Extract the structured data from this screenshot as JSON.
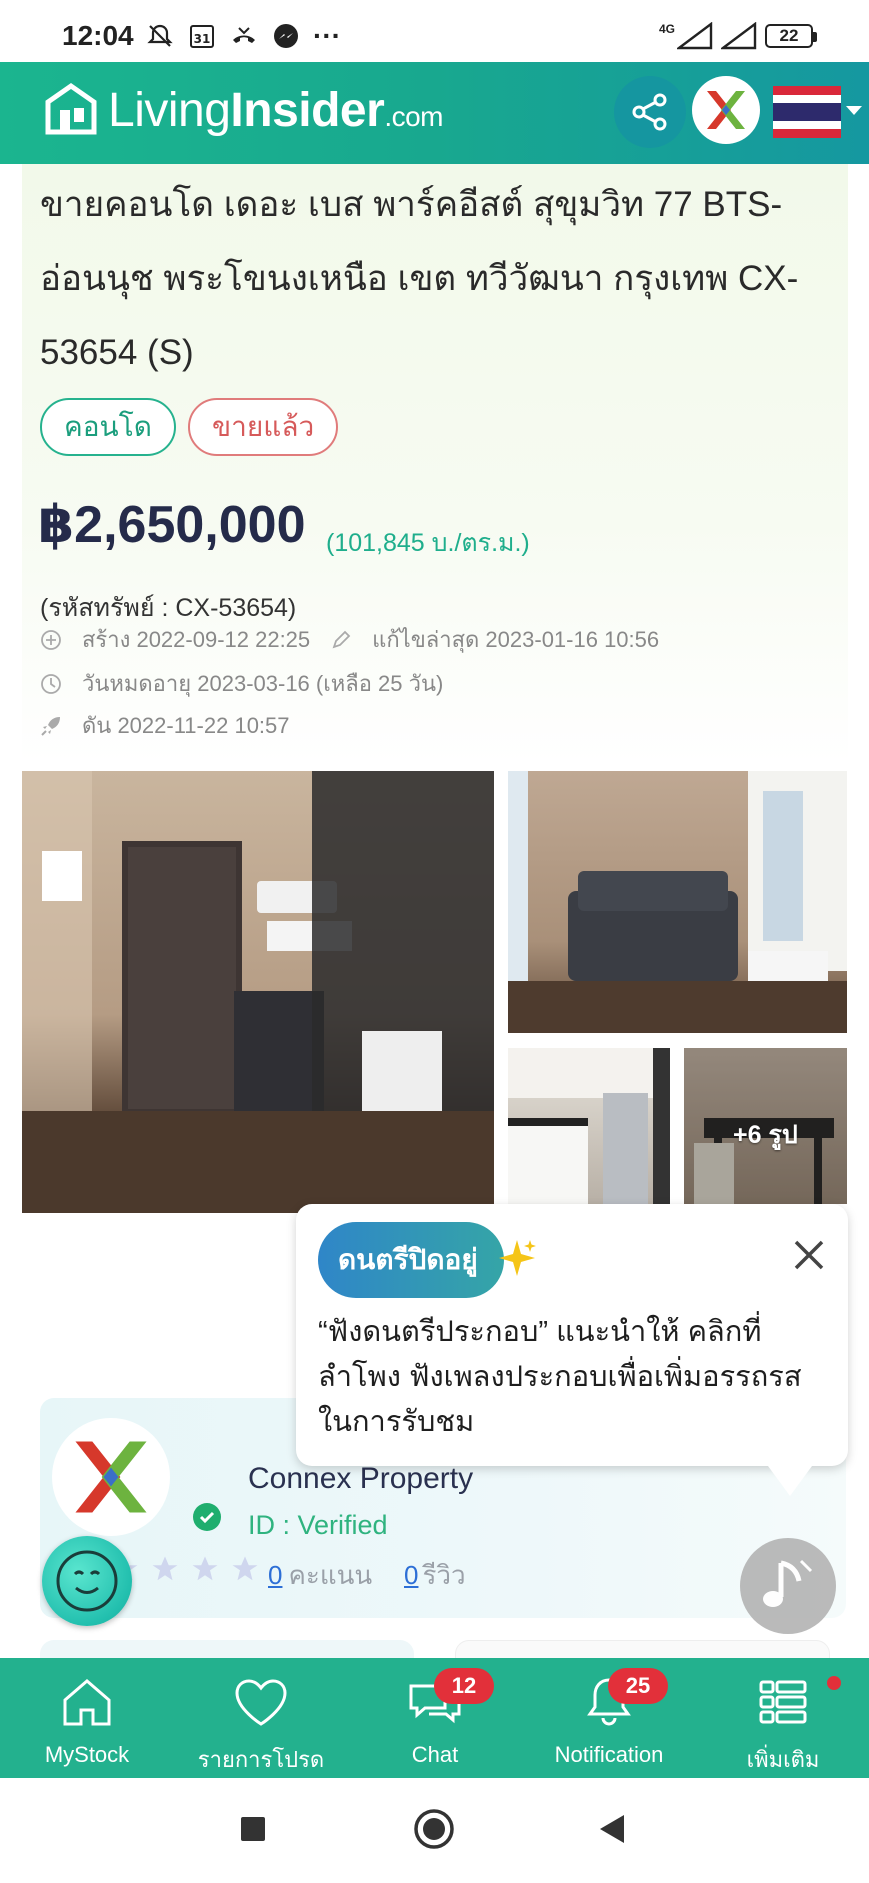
{
  "status_bar": {
    "time": "12:04",
    "calendar_day": "31",
    "more": "···",
    "network": "4G",
    "battery": "22"
  },
  "header": {
    "logo_light": "Living",
    "logo_bold": "Insider",
    "logo_com": ".com",
    "icons": [
      "share-icon",
      "connex-x-logo",
      "thai-flag-icon"
    ]
  },
  "listing": {
    "title": "ขายคอนโด เดอะ เบส พาร์คอีสต์ สุขุมวิท 77 BTS-อ่อนนุช พระโขนงเหนือ เขต ทวีวัฒนา กรุงเทพ CX-53654 (S)",
    "tag_type": "คอนโด",
    "tag_status": "ขายแล้ว",
    "price": "฿2,650,000",
    "price_per_sqm": "(101,845 บ./ตร.ม.)",
    "property_code": "(รหัสทรัพย์ : CX-53654)",
    "created": "สร้าง 2022-09-12 22:25",
    "last_edited": "แก้ไขล่าสุด 2023-01-16 10:56",
    "expires": "วันหมดอายุ 2023-03-16  (เหลือ 25 วัน)",
    "boosted": "ดัน 2022-11-22 10:57",
    "more_photos": "+6 รูป"
  },
  "agent": {
    "name": "Connex Property",
    "id_text": "ID : Verified",
    "score": "0",
    "score_label": "คะแนน",
    "reviews": "0",
    "reviews_label": "รีวิว"
  },
  "music_tip": {
    "badge": "ดนตรีปิดอยู่",
    "text": "“ฟังดนตรีประกอบ” แนะนำให้ คลิกที่ลำโพง ฟังเพลงประกอบเพื่อเพิ่มอรรถรสในการรับชม"
  },
  "bottom_nav": {
    "items": [
      {
        "label": "MyStock",
        "icon": "home-icon"
      },
      {
        "label": "รายการโปรด",
        "icon": "heart-icon"
      },
      {
        "label": "Chat",
        "icon": "chat-icon",
        "badge": "12"
      },
      {
        "label": "Notification",
        "icon": "bell-icon",
        "badge": "25"
      },
      {
        "label": "เพิ่มเติม",
        "icon": "menu-list-icon"
      }
    ]
  },
  "colors": {
    "brand_green": "#23b18e",
    "price_navy": "#252b4a",
    "accent_teal": "#1fae8c",
    "sold_red": "#d65a5a",
    "badge_red": "#e2303a"
  }
}
